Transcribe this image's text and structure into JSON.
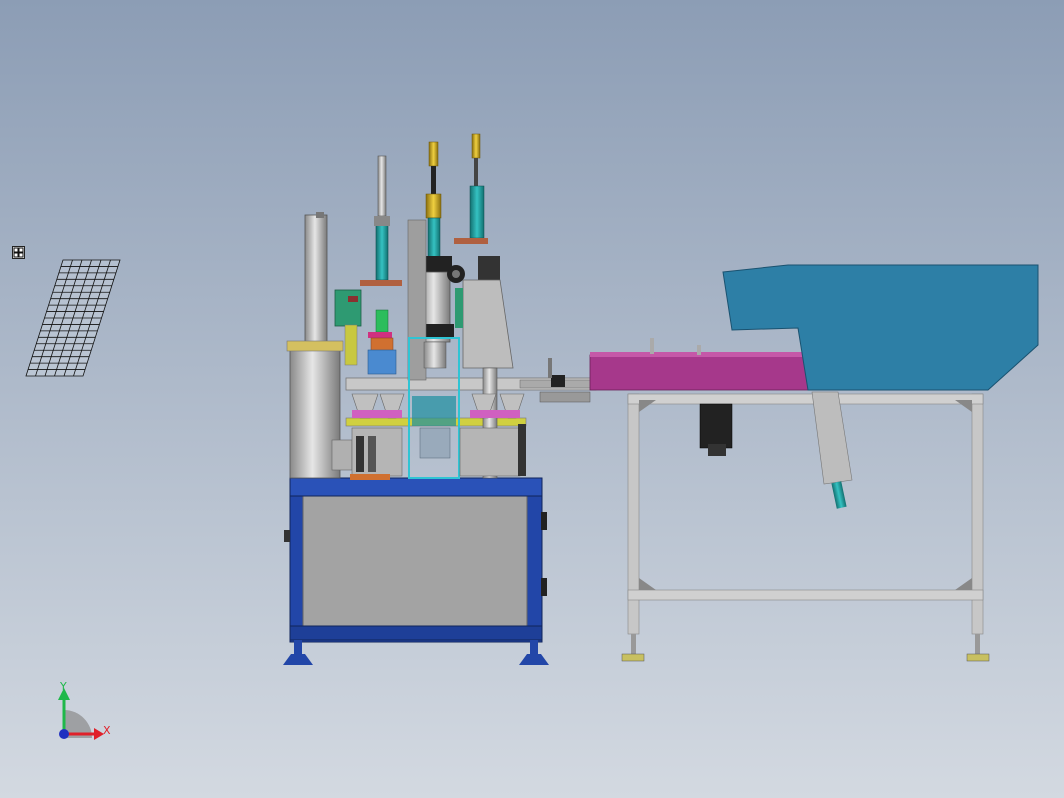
{
  "viewport": {
    "background_top": "#8c9db5",
    "background_bottom": "#d3d9e1"
  },
  "triad": {
    "x_label": "X",
    "y_label": "Y",
    "x_color": "#e0202a",
    "y_color": "#1fb84a",
    "z_color": "#2030c0"
  },
  "model": {
    "base_frame_color": "#2246a8",
    "panel_color": "#a3a3a3",
    "hopper_color": "#2d7fa6",
    "conveyor_color": "#a6388b",
    "table_frame_color": "#c7c7c7",
    "cylinder_teal": "#1f9a9a",
    "cylinder_yellow": "#c9a820"
  },
  "icons": {
    "select_handle": "move-handle-icon",
    "view_cube": "reference-grid-icon"
  }
}
